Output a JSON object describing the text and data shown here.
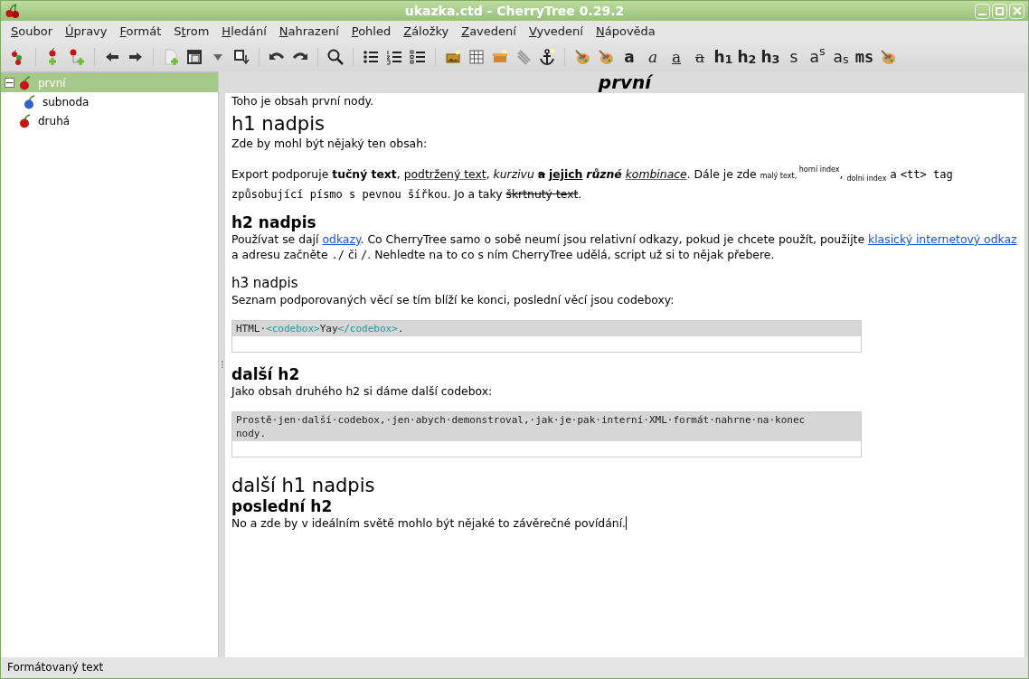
{
  "window": {
    "title": "ukazka.ctd - CherryTree 0.29.2"
  },
  "menu": [
    {
      "key": "S",
      "post": "oubor"
    },
    {
      "key": "Ú",
      "post": "pravy"
    },
    {
      "key": "F",
      "post": "ormát"
    },
    {
      "pre": "S",
      "key": "t",
      "post": "rom"
    },
    {
      "key": "H",
      "post": "ledání"
    },
    {
      "key": "N",
      "post": "ahrazení"
    },
    {
      "key": "P",
      "post": "ohled"
    },
    {
      "key": "Z",
      "post": "áložky"
    },
    {
      "key": "Z",
      "post": "avedení"
    },
    {
      "key": "V",
      "post": "yvedení"
    },
    {
      "key": "N",
      "post": "ápověda"
    }
  ],
  "toolbar": [
    [
      {
        "kind": "icon"
      }
    ],
    [
      {
        "kind": "icon"
      },
      {
        "kind": "icon"
      }
    ],
    [
      {
        "kind": "icon"
      },
      {
        "kind": "icon"
      }
    ],
    [
      {
        "kind": "icon"
      },
      {
        "kind": "icon"
      },
      {
        "kind": "icon"
      },
      {
        "kind": "icon"
      }
    ],
    [
      {
        "kind": "icon"
      },
      {
        "kind": "icon"
      }
    ],
    [
      {
        "kind": "icon"
      }
    ],
    [
      {
        "kind": "icon"
      },
      {
        "kind": "icon"
      },
      {
        "kind": "icon"
      }
    ],
    [
      {
        "kind": "icon"
      },
      {
        "kind": "icon"
      },
      {
        "kind": "icon"
      },
      {
        "kind": "icon"
      },
      {
        "kind": "icon"
      }
    ],
    [
      {
        "kind": "icon"
      },
      {
        "kind": "icon"
      },
      {
        "kind": "bold",
        "label": "a"
      },
      {
        "kind": "italic",
        "label": "a"
      },
      {
        "kind": "underline",
        "label": "a"
      },
      {
        "kind": "strike",
        "label": "a"
      },
      {
        "kind": "bold",
        "label": "h$_{1}$"
      },
      {
        "kind": "bold",
        "label": "h$_{2}$"
      },
      {
        "kind": "bold",
        "label": "h$_{3}$"
      },
      {
        "kind": "plain",
        "label": "s"
      },
      {
        "kind": "plain",
        "label": "a$^{s}$"
      },
      {
        "kind": "plain",
        "label": "a$_{s}$"
      },
      {
        "kind": "mono",
        "label": "ms"
      },
      {
        "kind": "icon"
      }
    ]
  ],
  "tree": [
    {
      "label": "první",
      "color": "#c01818",
      "selected": true,
      "expanded": true,
      "children": [
        {
          "label": "subnoda",
          "color": "#2f5fd0",
          "selected": false
        }
      ]
    },
    {
      "label": "druhá",
      "color": "#c01818",
      "selected": false
    }
  ],
  "node_title": "první",
  "content": [
    {
      "kind": "p",
      "segments": [
        {
          "kind": "plain",
          "text": "Toho je obsah první nody."
        }
      ]
    },
    {
      "kind": "h1",
      "segments": [
        {
          "kind": "plain",
          "text": "h1 nadpis"
        }
      ]
    },
    {
      "kind": "p",
      "segments": [
        {
          "kind": "plain",
          "text": "Zde by mohl být nějaký ten obsah:"
        }
      ]
    },
    {
      "kind": "gap"
    },
    {
      "kind": "p",
      "segments": [
        {
          "kind": "plain",
          "text": "Export podporuje "
        },
        {
          "kind": "bold",
          "text": "tučný text"
        },
        {
          "kind": "plain",
          "text": ", "
        },
        {
          "kind": "underline",
          "text": "podtržený text"
        },
        {
          "kind": "plain",
          "text": ", "
        },
        {
          "kind": "italic",
          "text": "kurzivu",
          "gap_after": true
        },
        {
          "kind": "bold-strike",
          "text": "a",
          "gap_after": true
        },
        {
          "kind": "bold-underline",
          "text": "jejich",
          "gap_after": true
        },
        {
          "kind": "bold-italic",
          "text": "různé",
          "gap_after": true
        },
        {
          "kind": "italic-underline",
          "text": "kombinace"
        },
        {
          "kind": "plain",
          "text": ". Dále je zde "
        },
        {
          "kind": "small",
          "text": "malý text,",
          "gap_after": true
        },
        {
          "kind": "sup",
          "text": "horní index"
        },
        {
          "kind": "plain",
          "text": ", "
        },
        {
          "kind": "sub",
          "text": "dolni index"
        },
        {
          "kind": "plain",
          "text": " a "
        },
        {
          "kind": "mono",
          "text": "<tt> tag způsobující písmo s pevnou šířkou"
        },
        {
          "kind": "plain",
          "text": ". Jo a taky "
        },
        {
          "kind": "strike",
          "text": "škrtnutý text"
        },
        {
          "kind": "plain",
          "text": "."
        }
      ]
    },
    {
      "kind": "gap"
    },
    {
      "kind": "h2",
      "segments": [
        {
          "kind": "plain",
          "text": "h2 nadpis"
        }
      ]
    },
    {
      "kind": "p",
      "segments": [
        {
          "kind": "plain",
          "text": "Používat se dají "
        },
        {
          "kind": "link",
          "text": "odkazy"
        },
        {
          "kind": "plain",
          "text": ". Co CherryTree samo o sobě neumí jsou relativní odkazy, pokud je chcete použít, použijte "
        },
        {
          "kind": "link",
          "text": "klasický internetový odkaz"
        },
        {
          "kind": "plain",
          "text": " a adresu začněte "
        },
        {
          "kind": "mono",
          "text": "./"
        },
        {
          "kind": "plain",
          "text": " či "
        },
        {
          "kind": "mono",
          "text": "/"
        },
        {
          "kind": "plain",
          "text": ". Nehledte na to co s ním CherryTree udělá, script už si to nějak přebere."
        }
      ]
    },
    {
      "kind": "gap"
    },
    {
      "kind": "h3",
      "segments": [
        {
          "kind": "plain",
          "text": "h3 nadpis"
        }
      ]
    },
    {
      "kind": "p",
      "segments": [
        {
          "kind": "plain",
          "text": "Seznam podporovaných věcí se tím blíží ke konci, poslední věcí jsou codeboxy:"
        }
      ]
    },
    {
      "kind": "gap"
    },
    {
      "kind": "code",
      "lines": [
        [
          {
            "kind": "text",
            "text": "HTML·"
          },
          {
            "kind": "tag",
            "text": "<codebox>"
          },
          {
            "kind": "text",
            "text": "Yay"
          },
          {
            "kind": "tag",
            "text": "</codebox>"
          },
          {
            "kind": "text",
            "text": "."
          }
        ]
      ]
    },
    {
      "kind": "gap"
    },
    {
      "kind": "h2",
      "segments": [
        {
          "kind": "plain",
          "text": "další h2"
        }
      ]
    },
    {
      "kind": "p",
      "segments": [
        {
          "kind": "plain",
          "text": "Jako obsah druhého h2 si dáme další codebox:"
        }
      ]
    },
    {
      "kind": "gap"
    },
    {
      "kind": "code",
      "lines": [
        [
          {
            "kind": "text",
            "text": "Prostě·jen·další·codebox,·jen·abych·demonstroval,·jak·je·pak·interní·XML·formát·nahrne·na·konec"
          }
        ],
        [
          {
            "kind": "text",
            "text": "nody."
          }
        ]
      ]
    },
    {
      "kind": "gap"
    },
    {
      "kind": "h1",
      "segments": [
        {
          "kind": "plain",
          "text": "další h1 nadpis"
        }
      ]
    },
    {
      "kind": "h2",
      "segments": [
        {
          "kind": "plain",
          "text": "poslední h2"
        }
      ]
    },
    {
      "kind": "p",
      "cursor": true,
      "segments": [
        {
          "kind": "plain",
          "text": "No a zde by v ideálním světě mohlo být nějaké to závěrečné povídání."
        }
      ]
    }
  ],
  "status_bar": "Formátovaný text"
}
